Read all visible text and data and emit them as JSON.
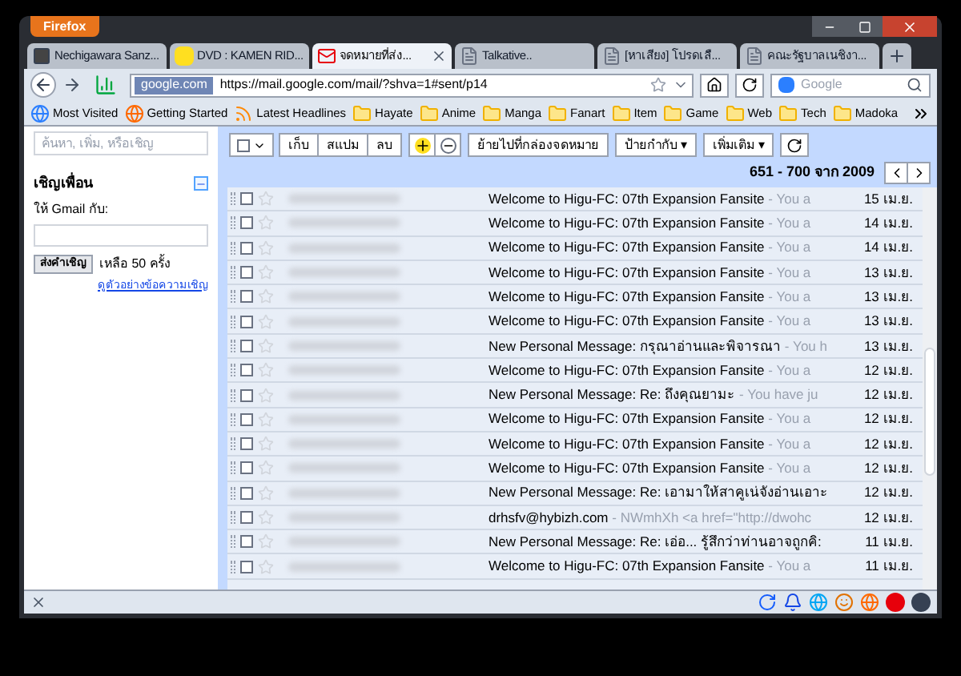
{
  "app_button": "Firefox",
  "tabs": [
    {
      "label": "Nechigawara Sanz...",
      "kind": "app",
      "selected": false
    },
    {
      "label": "DVD : KAMEN RID...",
      "kind": "k",
      "selected": false
    },
    {
      "label": "จดหมายที่ส่ง...",
      "kind": "mail",
      "selected": true
    },
    {
      "label": "Talkative..",
      "kind": "page",
      "selected": false
    },
    {
      "label": "[หาเสียง] โปรดเลื...",
      "kind": "page",
      "selected": false
    },
    {
      "label": "คณะรัฐบาลเนชิงา...",
      "kind": "page",
      "selected": false
    }
  ],
  "address": {
    "identity": "google.com",
    "url": "https://mail.google.com/mail/?shva=1#sent/p14"
  },
  "search": {
    "placeholder": "Google"
  },
  "bookmarks": [
    {
      "label": "Most Visited",
      "kind": "smart"
    },
    {
      "label": "Getting Started",
      "kind": "firefox"
    },
    {
      "label": "Latest Headlines",
      "kind": "feed"
    },
    {
      "label": "Hayate",
      "kind": "folder"
    },
    {
      "label": "Anime",
      "kind": "folder"
    },
    {
      "label": "Manga",
      "kind": "folder"
    },
    {
      "label": "Fanart",
      "kind": "folder"
    },
    {
      "label": "Item",
      "kind": "folder"
    },
    {
      "label": "Game",
      "kind": "folder"
    },
    {
      "label": "Web",
      "kind": "folder"
    },
    {
      "label": "Tech",
      "kind": "folder"
    },
    {
      "label": "Madoka",
      "kind": "folder"
    }
  ],
  "sidebar": {
    "search_placeholder": "ค้นหา, เพิ่ม, หรือเชิญ",
    "invite_title": "เชิญเพื่อน",
    "invite_label": "ให้ Gmail กับ:",
    "send_button": "ส่งคำเชิญ",
    "remaining": "เหลือ 50 ครั้ง",
    "preview_link": "ดูตัวอย่างข้อความเชิญ"
  },
  "toolbar": {
    "buttons": [
      "เก็บ",
      "สแปม",
      "ลบ"
    ],
    "move_button": "ย้ายไปที่กล่องจดหมาย",
    "labels_button": "ป้ายกำกับ ▾",
    "more_button": "เพิ่มเติม ▾",
    "range": "651 - 700 จาก 2009"
  },
  "rows": [
    {
      "checked": false,
      "subject": "Welcome to Higu-FC: 07th Expansion Fansite",
      "snippet": " - You a",
      "date": "15 เม.ย."
    },
    {
      "checked": false,
      "subject": "Welcome to Higu-FC: 07th Expansion Fansite",
      "snippet": " - You a",
      "date": "14 เม.ย."
    },
    {
      "checked": false,
      "subject": "Welcome to Higu-FC: 07th Expansion Fansite",
      "snippet": " - You a",
      "date": "14 เม.ย."
    },
    {
      "checked": false,
      "subject": "Welcome to Higu-FC: 07th Expansion Fansite",
      "snippet": " - You a",
      "date": "13 เม.ย."
    },
    {
      "checked": false,
      "subject": "Welcome to Higu-FC: 07th Expansion Fansite",
      "snippet": " - You a",
      "date": "13 เม.ย."
    },
    {
      "checked": false,
      "subject": "Welcome to Higu-FC: 07th Expansion Fansite",
      "snippet": " - You a",
      "date": "13 เม.ย."
    },
    {
      "checked": false,
      "subject": "New Personal Message: กรุณาอ่านและพิจารณา",
      "snippet": " - You h",
      "date": "13 เม.ย."
    },
    {
      "checked": false,
      "subject": "Welcome to Higu-FC: 07th Expansion Fansite",
      "snippet": " - You a",
      "date": "12 เม.ย."
    },
    {
      "checked": false,
      "subject": "New Personal Message: Re: ถึงคุณยามะ",
      "snippet": " - You have ju",
      "date": "12 เม.ย."
    },
    {
      "checked": false,
      "subject": "Welcome to Higu-FC: 07th Expansion Fansite",
      "snippet": " - You a",
      "date": "12 เม.ย."
    },
    {
      "checked": false,
      "subject": "Welcome to Higu-FC: 07th Expansion Fansite",
      "snippet": " - You a",
      "date": "12 เม.ย."
    },
    {
      "checked": false,
      "subject": "Welcome to Higu-FC: 07th Expansion Fansite",
      "snippet": " - You a",
      "date": "12 เม.ย."
    },
    {
      "checked": false,
      "subject": "New Personal Message: Re: เอามาให้สาคูเน่จังอ่านเอาะ",
      "snippet": "",
      "date": "12 เม.ย."
    },
    {
      "checked": false,
      "subject": "drhsfv@hybizh.com",
      "snippet": " - NWmhXh <a href=\"http://dwohc",
      "date": "12 เม.ย."
    },
    {
      "checked": false,
      "subject": "New Personal Message: Re: เอ่อ... รู้สึกว่าท่านอาจถูกคิ:",
      "snippet": "",
      "date": "11 เม.ย."
    },
    {
      "checked": false,
      "subject": "Welcome to Higu-FC: 07th Expansion Fansite",
      "snippet": " - You a",
      "date": "11 เม.ย."
    }
  ]
}
